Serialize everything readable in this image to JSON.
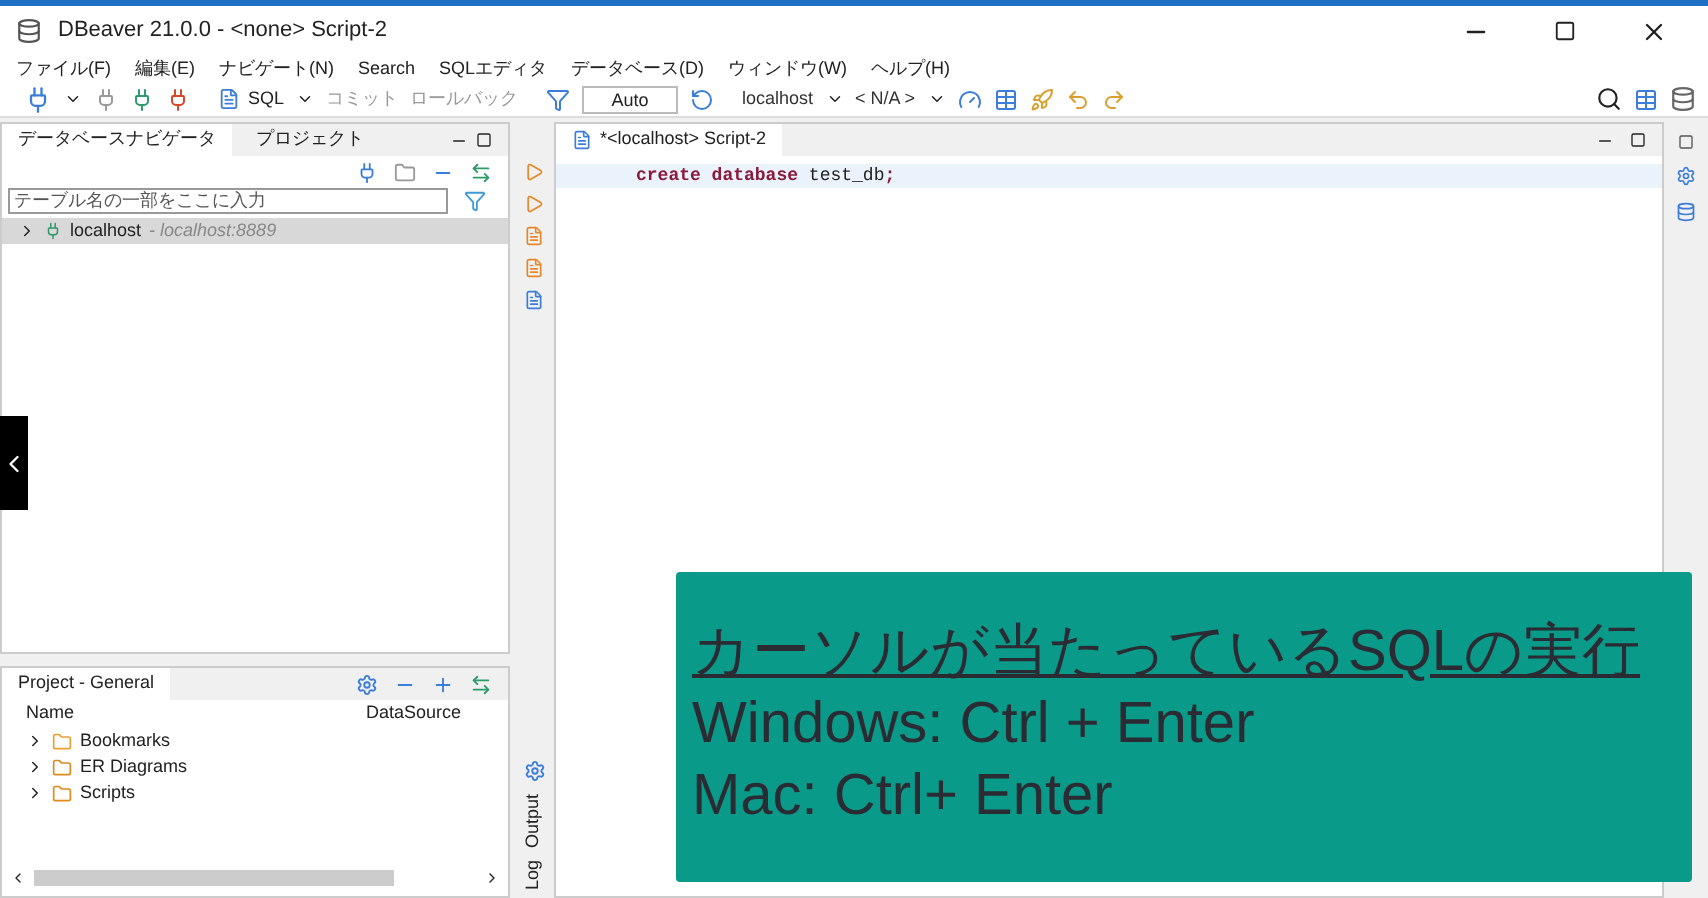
{
  "window": {
    "title": "DBeaver 21.0.0 - <none> Script-2"
  },
  "menu": [
    "ファイル(F)",
    "編集(E)",
    "ナビゲート(N)",
    "Search",
    "SQLエディタ",
    "データベース(D)",
    "ウィンドウ(W)",
    "ヘルプ(H)"
  ],
  "toolbar": {
    "sql": "SQL",
    "commit": "コミット",
    "rollback": "ロールバック",
    "mode": "Auto",
    "connection": "localhost",
    "schema": "< N/A >"
  },
  "navigator": {
    "tabs": [
      {
        "label": "データベースナビゲータ",
        "selected": true
      },
      {
        "label": "プロジェクト",
        "selected": false
      }
    ],
    "filter": {
      "placeholder": "テーブル名の一部をここに入力"
    },
    "items": [
      {
        "name": "localhost",
        "detail": " - localhost:8889",
        "selected": true
      }
    ]
  },
  "project": {
    "title": "Project - General",
    "columns": [
      "Name",
      "DataSource"
    ],
    "items": [
      {
        "name": "Bookmarks",
        "kind": "bookmarks"
      },
      {
        "name": "ER Diagrams",
        "kind": "diagrams"
      },
      {
        "name": "Scripts",
        "kind": "scripts"
      }
    ]
  },
  "side_tabs": [
    "Output",
    "Log"
  ],
  "editor": {
    "tab": "*<localhost> Script-2",
    "code": [
      {
        "kind": "keyword",
        "text": "create database"
      },
      {
        "kind": "plain",
        "text": " test_db"
      },
      {
        "kind": "keyword",
        "text": ";"
      }
    ]
  },
  "caption": {
    "title": "カーソルが当たっているSQLの実行",
    "lines": [
      "Windows: Ctrl + Enter",
      "Mac: Ctrl+ Enter"
    ]
  }
}
